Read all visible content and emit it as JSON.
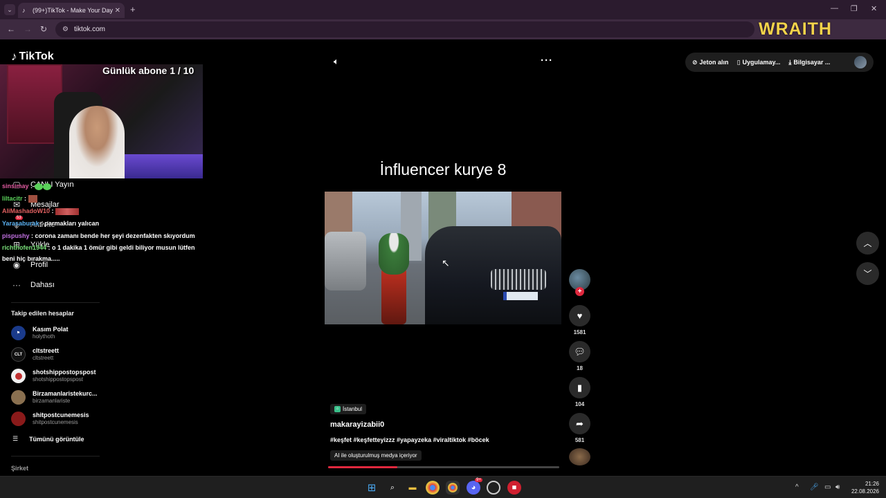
{
  "browser": {
    "tab_title": "(99+)TikTok - Make Your Day",
    "url": "tiktok.com",
    "overlay_text": "WRAITH"
  },
  "tiktok": {
    "logo_text": "TikTok",
    "top_actions": [
      "Jeton alın",
      "Uygulamay...",
      "Bilgisayar ..."
    ]
  },
  "stream_overlay": {
    "sub_goal": "Günlük abone 1 / 10"
  },
  "sidebar": {
    "items": [
      {
        "label": "CANLI Yayın",
        "icon": "live-icon"
      },
      {
        "label": "Mesajlar",
        "icon": "message-icon"
      },
      {
        "label": "Aktivite",
        "icon": "activity-icon",
        "badge": "53"
      },
      {
        "label": "Yükle",
        "icon": "upload-icon"
      },
      {
        "label": "Profil",
        "icon": "profile-icon"
      },
      {
        "label": "Dahası",
        "icon": "more-icon"
      }
    ],
    "following_title": "Takip edilen hesaplar",
    "following": [
      {
        "name": "Kasım Polat",
        "handle": "holythoth",
        "color": "#1a3a8a"
      },
      {
        "name": "cltstreett",
        "handle": "cltstreett",
        "color": "#111111",
        "avatar_text": "CLT"
      },
      {
        "name": "shotshippostopspost",
        "handle": "shotshippostopspost",
        "color": "#c03030"
      },
      {
        "name": "Birzamanlaristekurc...",
        "handle": "birzamanlariste",
        "color": "#8a7050"
      },
      {
        "name": "shitpostcunemesis",
        "handle": "shitpostcunemesis",
        "color": "#8a1a1a"
      }
    ],
    "show_all": "Tümünü görüntüle",
    "company": "Şirket"
  },
  "chat": [
    {
      "user": "sinsimay",
      "text": " :",
      "cls": "u1",
      "emotes": "green"
    },
    {
      "user": "liltacitr",
      "text": " :",
      "cls": "u2",
      "emotes": "small"
    },
    {
      "user": "AliMashadoW10",
      "text": " :",
      "cls": "u3",
      "emotes": "red"
    },
    {
      "user": "Yarasaburak",
      "text": " : parmakları yalıcan",
      "cls": "u4"
    },
    {
      "user": "pispushy",
      "text": " : corona zamanı bende her şeyi dezenfakten skıyordum",
      "cls": "u5"
    },
    {
      "user": "richthofen1944",
      "text": " : o 1 dakika 1 ömür gibi geldi biliyor musun lütfen",
      "cls": "u6"
    },
    {
      "user": "",
      "text": "beni hiç bırakma.....",
      "cls": ""
    }
  ],
  "video": {
    "title": "İnfluencer kurye 8",
    "location": "İstanbul",
    "author": "makarayizabii0",
    "hashtags": "#keşfet #keşfetteyizzz #yapayzeka #viraltiktok #böcek",
    "ai_label": "AI ile oluşturulmuş medya içeriyor",
    "progress": 0.3
  },
  "actions": {
    "likes": "1581",
    "comments": "18",
    "bookmarks": "104",
    "shares": "581"
  },
  "taskbar": {
    "time": "21:26",
    "date": "22.08.2026",
    "discord_badge": "9+"
  }
}
